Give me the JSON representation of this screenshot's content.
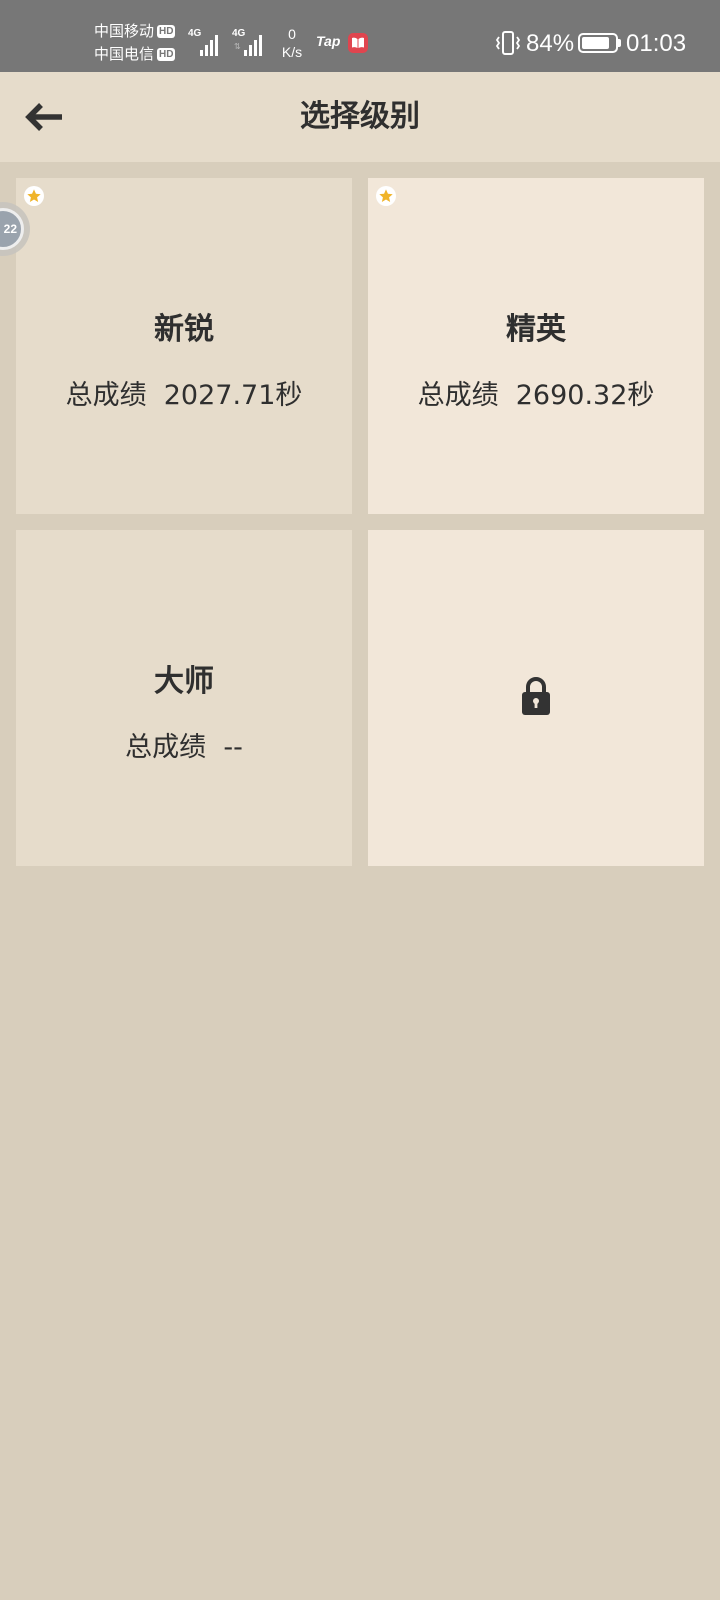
{
  "status_bar": {
    "carrier_1": "中国移动",
    "carrier_2": "中国电信",
    "hd_label": "HD",
    "network_1": "4G",
    "network_2": "4G",
    "speed_value": "0",
    "speed_unit": "K/s",
    "app_label": "Tap",
    "battery_percent": "84%",
    "battery_level": 0.84,
    "time": "01:03"
  },
  "header": {
    "title": "选择级别",
    "back_icon": "arrow-left-icon"
  },
  "levels": [
    {
      "name": "新锐",
      "score_label": "总成绩",
      "score_value": "2027.71秒",
      "starred": true,
      "locked": false
    },
    {
      "name": "精英",
      "score_label": "总成绩",
      "score_value": "2690.32秒",
      "starred": true,
      "locked": false
    },
    {
      "name": "大师",
      "score_label": "总成绩",
      "score_value": "--",
      "starred": false,
      "locked": false
    },
    {
      "name": "",
      "score_label": "",
      "score_value": "",
      "starred": false,
      "locked": true,
      "icon": "lock-icon"
    }
  ],
  "floating_ball": {
    "label": "22"
  },
  "colors": {
    "page_background": "#d8cebc",
    "card_dark": "#e6dccb",
    "card_light": "#f2e7d9",
    "text": "#2f2f2f",
    "star": "#f0b429",
    "status_bar": "#777777"
  }
}
